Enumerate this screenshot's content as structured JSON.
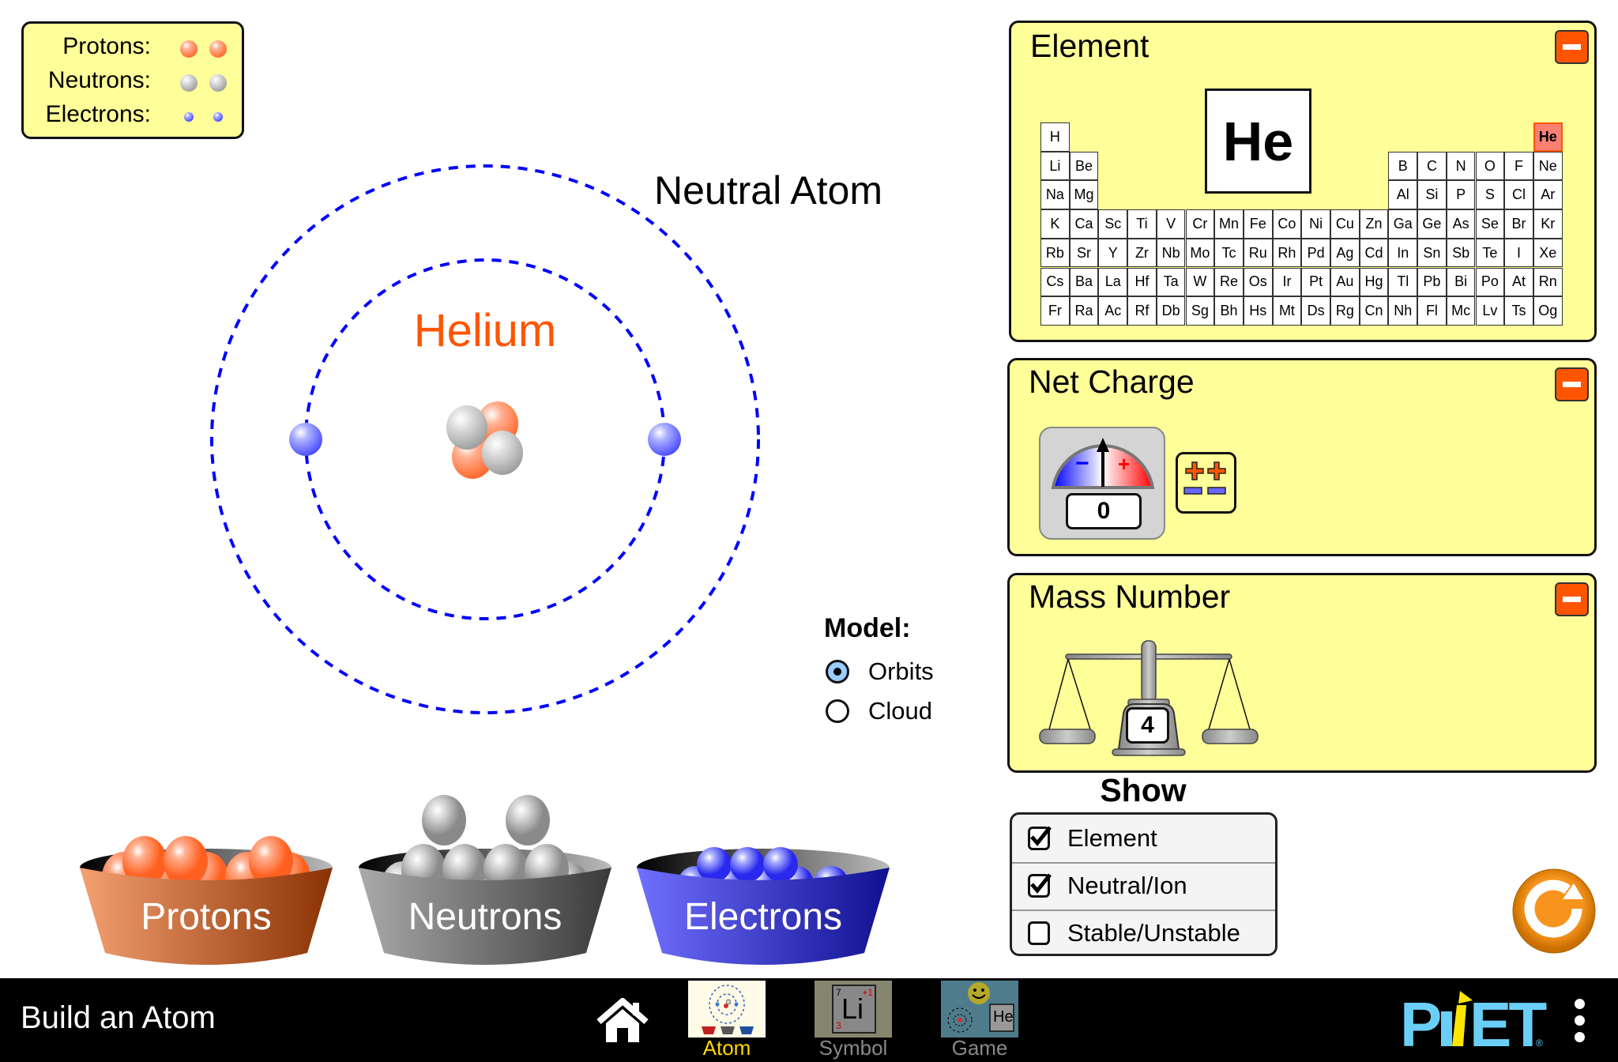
{
  "legend": {
    "rows": [
      {
        "label": "Protons:",
        "kind": "proton",
        "count": 2
      },
      {
        "label": "Neutrons:",
        "kind": "neutron",
        "count": 2
      },
      {
        "label": "Electrons:",
        "kind": "electron",
        "count": 2
      }
    ]
  },
  "atom": {
    "element_name": "Helium",
    "charge_status": "Neutral Atom",
    "protons": 2,
    "neutrons": 2,
    "electrons": 2,
    "colors": {
      "element_name": "#ff5500",
      "orbit": "#0000ff"
    }
  },
  "model": {
    "title": "Model:",
    "options": [
      {
        "label": "Orbits",
        "selected": true
      },
      {
        "label": "Cloud",
        "selected": false
      }
    ]
  },
  "buckets": [
    {
      "label": "Protons",
      "kind": "proton"
    },
    {
      "label": "Neutrons",
      "kind": "neutron"
    },
    {
      "label": "Electrons",
      "kind": "electron"
    }
  ],
  "element_panel": {
    "title": "Element",
    "symbol": "He",
    "selected_symbol": "He",
    "rows": [
      [
        "H",
        "",
        "",
        "",
        "",
        "",
        "",
        "",
        "",
        "",
        "",
        "",
        "",
        "",
        "",
        "",
        "",
        "He"
      ],
      [
        "Li",
        "Be",
        "",
        "",
        "",
        "",
        "",
        "",
        "",
        "",
        "",
        "",
        "B",
        "C",
        "N",
        "O",
        "F",
        "Ne"
      ],
      [
        "Na",
        "Mg",
        "",
        "",
        "",
        "",
        "",
        "",
        "",
        "",
        "",
        "",
        "Al",
        "Si",
        "P",
        "S",
        "Cl",
        "Ar"
      ],
      [
        "K",
        "Ca",
        "Sc",
        "Ti",
        "V",
        "Cr",
        "Mn",
        "Fe",
        "Co",
        "Ni",
        "Cu",
        "Zn",
        "Ga",
        "Ge",
        "As",
        "Se",
        "Br",
        "Kr"
      ],
      [
        "Rb",
        "Sr",
        "Y",
        "Zr",
        "Nb",
        "Mo",
        "Tc",
        "Ru",
        "Rh",
        "Pd",
        "Ag",
        "Cd",
        "In",
        "Sn",
        "Sb",
        "Te",
        "I",
        "Xe"
      ],
      [
        "Cs",
        "Ba",
        "La",
        "Hf",
        "Ta",
        "W",
        "Re",
        "Os",
        "Ir",
        "Pt",
        "Au",
        "Hg",
        "Tl",
        "Pb",
        "Bi",
        "Po",
        "At",
        "Rn"
      ],
      [
        "Fr",
        "Ra",
        "Ac",
        "Rf",
        "Db",
        "Sg",
        "Bh",
        "Hs",
        "Mt",
        "Ds",
        "Rg",
        "Cn",
        "Nh",
        "Fl",
        "Mc",
        "Lv",
        "Ts",
        "Og"
      ]
    ]
  },
  "net_charge_panel": {
    "title": "Net Charge",
    "value": "0",
    "meter_minus": "−",
    "meter_plus": "+"
  },
  "mass_number_panel": {
    "title": "Mass Number",
    "value": "4"
  },
  "show": {
    "title": "Show",
    "options": [
      {
        "label": "Element",
        "checked": true
      },
      {
        "label": "Neutral/Ion",
        "checked": true
      },
      {
        "label": "Stable/Unstable",
        "checked": false
      }
    ]
  },
  "navbar": {
    "title": "Build an Atom",
    "screens": [
      {
        "label": "Atom",
        "active": true
      },
      {
        "label": "Symbol",
        "active": false
      },
      {
        "label": "Game",
        "active": false
      }
    ],
    "symbol_icon": {
      "mass": "7",
      "charge": "+1",
      "symbol": "Li",
      "number": "3"
    },
    "game_icon": {
      "symbol": "He"
    },
    "brand": "PhET",
    "colors": {
      "active": "#ffd700",
      "inactive": "#888888",
      "brand_blue": "#6acff6",
      "brand_yellow": "#ffe500"
    }
  }
}
